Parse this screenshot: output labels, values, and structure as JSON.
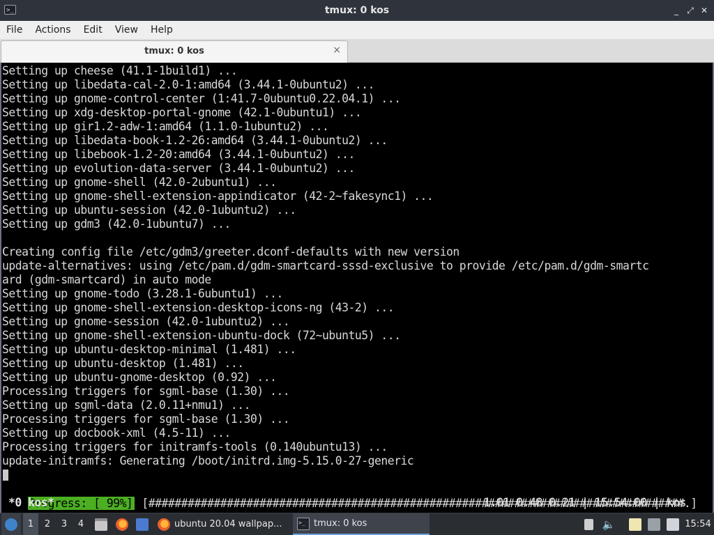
{
  "window": {
    "title": "tmux: 0 kos",
    "app_icon": ">_",
    "buttons": [
      "_",
      "⤢",
      "✕"
    ]
  },
  "menu": [
    "File",
    "Actions",
    "Edit",
    "View",
    "Help"
  ],
  "tab": {
    "label": "tmux: 0 kos",
    "close": "×"
  },
  "terminal": {
    "lines": [
      "Setting up cheese (41.1-1build1) ...",
      "Setting up libedata-cal-2.0-1:amd64 (3.44.1-0ubuntu2) ...",
      "Setting up gnome-control-center (1:41.7-0ubuntu0.22.04.1) ...",
      "Setting up xdg-desktop-portal-gnome (42.1-0ubuntu1) ...",
      "Setting up gir1.2-adw-1:amd64 (1.1.0-1ubuntu2) ...",
      "Setting up libedata-book-1.2-26:amd64 (3.44.1-0ubuntu2) ...",
      "Setting up libebook-1.2-20:amd64 (3.44.1-0ubuntu2) ...",
      "Setting up evolution-data-server (3.44.1-0ubuntu2) ...",
      "Setting up gnome-shell (42.0-2ubuntu1) ...",
      "Setting up gnome-shell-extension-appindicator (42-2~fakesync1) ...",
      "Setting up ubuntu-session (42.0-1ubuntu2) ...",
      "Setting up gdm3 (42.0-1ubuntu7) ...",
      "",
      "Creating config file /etc/gdm3/greeter.dconf-defaults with new version",
      "update-alternatives: using /etc/pam.d/gdm-smartcard-sssd-exclusive to provide /etc/pam.d/gdm-smartc",
      "ard (gdm-smartcard) in auto mode",
      "Setting up gnome-todo (3.28.1-6ubuntu1) ...",
      "Setting up gnome-shell-extension-desktop-icons-ng (43-2) ...",
      "Setting up gnome-session (42.0-1ubuntu2) ...",
      "Setting up gnome-shell-extension-ubuntu-dock (72~ubuntu5) ...",
      "Setting up ubuntu-desktop-minimal (1.481) ...",
      "Setting up ubuntu-desktop (1.481) ...",
      "Setting up ubuntu-gnome-desktop (0.92) ...",
      "Processing triggers for sgml-base (1.30) ...",
      "Setting up sgml-data (2.0.11+nmu1) ...",
      "Processing triggers for sgml-base (1.30) ...",
      "Setting up docbook-xml (4.5-11) ...",
      "Processing triggers for initramfs-tools (0.140ubuntu13) ...",
      "update-initramfs: Generating /boot/initrd.img-5.15.0-27-generic"
    ],
    "progress_label": "Progress: [ 99%]",
    "progress_bar": "[##################################################################################.]",
    "progress_percent": 99
  },
  "tmux_status": {
    "window": "*0 kos*",
    "right": "1.01 0.48 0.21 | 15:54:00 | kos"
  },
  "taskbar": {
    "workspaces": [
      "1",
      "2",
      "3",
      "4"
    ],
    "tasks": [
      {
        "label": "ubuntu 20.04 wallpap..."
      },
      {
        "label": "tmux: 0 kos"
      }
    ],
    "clock": "15:54"
  }
}
